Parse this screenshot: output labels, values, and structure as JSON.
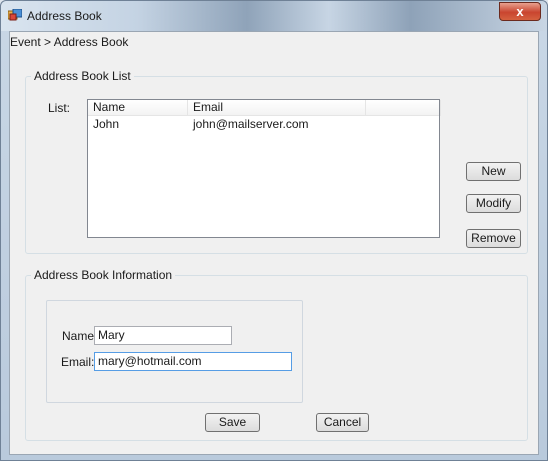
{
  "window": {
    "title": "Address Book",
    "close_label": "x"
  },
  "breadcrumb": "Event > Address Book",
  "list_group": {
    "legend": "Address Book List",
    "list_label": "List:",
    "columns": [
      "Name",
      "Email",
      ""
    ],
    "rows": [
      {
        "name": "John",
        "email": "john@mailserver.com"
      }
    ],
    "buttons": {
      "new": "New",
      "modify": "Modify",
      "remove": "Remove"
    }
  },
  "info_group": {
    "legend": "Address Book Information",
    "name_label": "Name:",
    "name_value": "Mary",
    "email_label": "Email:",
    "email_value": "mary@hotmail.com",
    "save": "Save",
    "cancel": "Cancel"
  },
  "colors": {
    "focus_border": "#569de5",
    "close_button": "#c9452f"
  },
  "icons": {
    "app": "address-book-icon",
    "close": "close-icon"
  }
}
